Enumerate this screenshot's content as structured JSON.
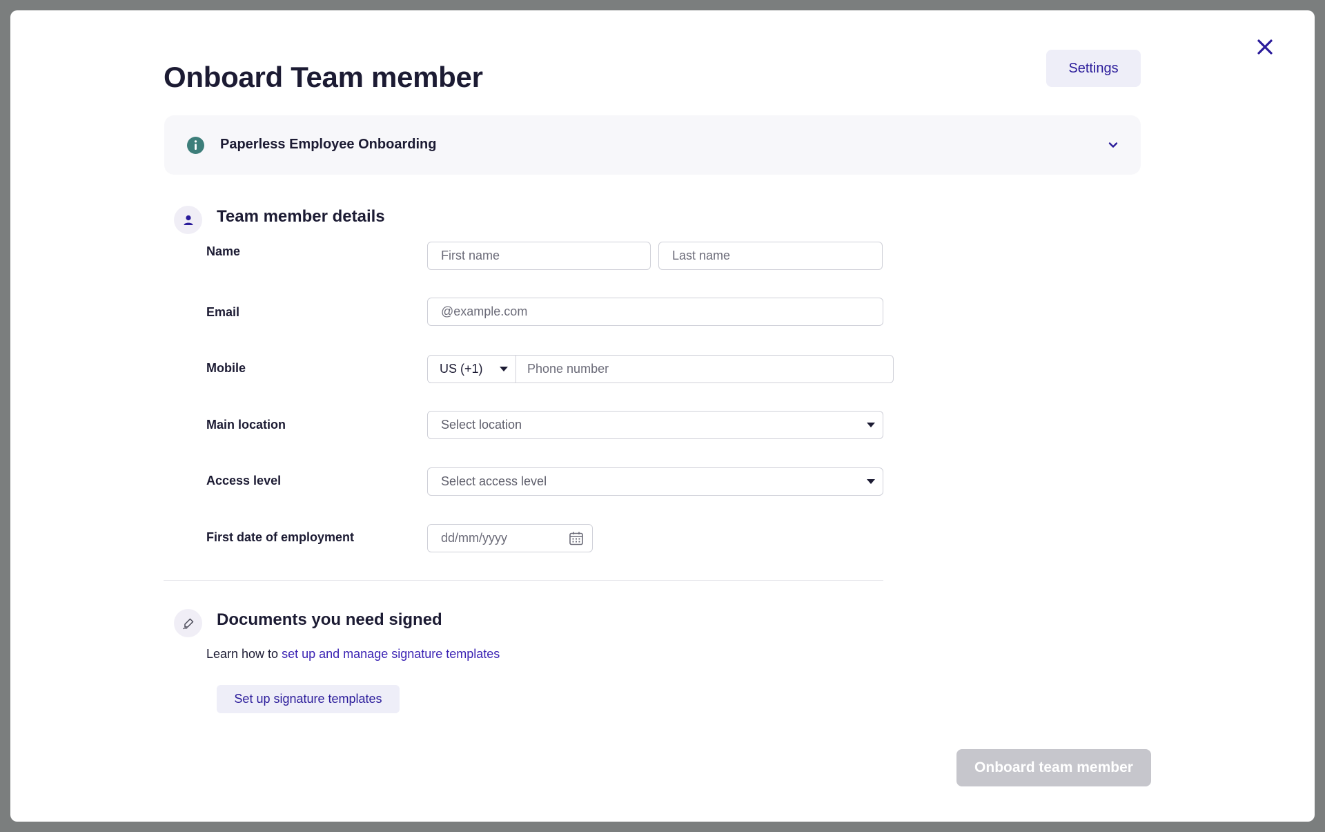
{
  "dialog": {
    "title": "Onboard Team member",
    "settings_label": "Settings",
    "close_icon": "close-icon"
  },
  "banner": {
    "text": "Paperless Employee Onboarding",
    "icon": "info-icon",
    "expanded": false
  },
  "details": {
    "section_title": "Team member details",
    "icon": "person-icon",
    "fields": {
      "name_label": "Name",
      "first_name_placeholder": "First name",
      "last_name_placeholder": "Last name",
      "email_label": "Email",
      "email_placeholder": "@example.com",
      "mobile_label": "Mobile",
      "country_code_value": "US (+1)",
      "phone_placeholder": "Phone number",
      "location_label": "Main location",
      "location_placeholder": "Select location",
      "access_label": "Access level",
      "access_placeholder": "Select access level",
      "start_date_label": "First date of employment",
      "start_date_placeholder": "dd/mm/yyyy"
    }
  },
  "documents": {
    "section_title": "Documents you need signed",
    "icon": "signature-pen-icon",
    "learn_prefix": "Learn how to",
    "learn_link": "set up and manage signature templates",
    "setup_button": "Set up signature templates"
  },
  "footer": {
    "submit_label": "Onboard team member",
    "submit_enabled": false
  },
  "colors": {
    "accent": "#2a1b9a",
    "title": "#1c1b33",
    "info_icon": "#3d7e7a",
    "disabled_button": "#c6c6cc",
    "backdrop": "#7b7e7e"
  }
}
